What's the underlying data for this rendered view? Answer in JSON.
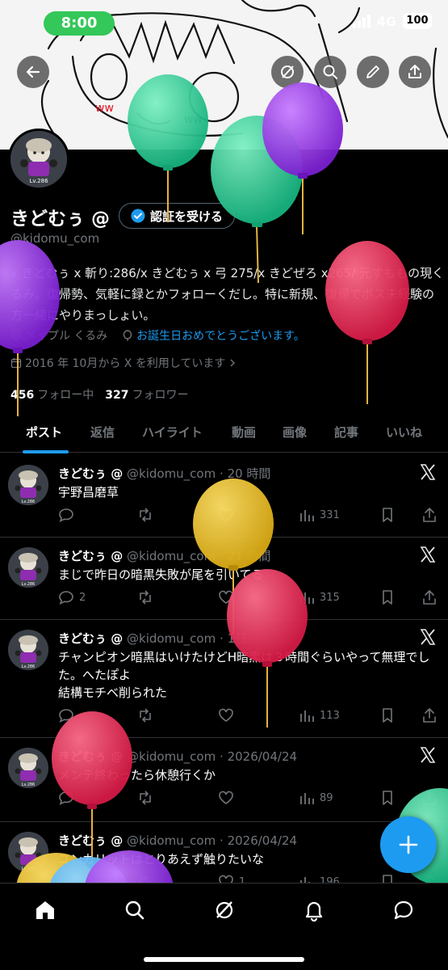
{
  "status_bar": {
    "time": "8:00",
    "network": "4G",
    "battery": "100",
    "accent": "#34c759"
  },
  "top_nav": {
    "icons": [
      "back-arrow-icon",
      "grok-icon",
      "search-icon",
      "pencil-icon",
      "share-icon"
    ]
  },
  "profile": {
    "display_name": "きどむぅ @",
    "verify_label": "認証を受ける",
    "handle": "@kidomu_com",
    "bio_prefix": "x",
    "bio_text": "きどむぅ x 斬り:286/x きどむぅ x 弓 275/x きどぜろ x265/ 元すももの現くるみ。復帰勢、気軽に録とかフォローくだし。特に新規、復帰でボス未経験の方一緒にやりまっしょい。",
    "location": "メイプル くるみ",
    "birthday_link": "お誕生日おめでとうございます。",
    "joined": "2016 年 10月から X を利用しています",
    "following_count": "456",
    "following_label": "フォロー中",
    "followers_count": "327",
    "followers_label": "フォロワー",
    "avatar_level": "Lv.286"
  },
  "tabs": [
    "ポスト",
    "返信",
    "ハイライト",
    "動画",
    "画像",
    "記事",
    "いいね"
  ],
  "posts": [
    {
      "name": "きどむぅ @",
      "handle": "@kidomu_com",
      "time": "20 時間",
      "text": "宇野昌磨草",
      "replies": "",
      "reposts": "",
      "likes": "",
      "views": "331"
    },
    {
      "name": "きどむぅ @",
      "handle": "@kidomu_com",
      "time": "21 時間",
      "text": "まじで昨日の暗黒失敗が尾を引いてる",
      "replies": "2",
      "reposts": "",
      "likes": "",
      "views": "315"
    },
    {
      "name": "きどむぅ @",
      "handle": "@kidomu_com",
      "time": "1日",
      "text": "チャンピオン暗黒はいけたけどH暗黒は３時間ぐらいやって無理でした。へたぽよ\n結構モチベ削られた",
      "replies": "",
      "reposts": "",
      "likes": "",
      "views": "113"
    },
    {
      "name": "きどむぅ @",
      "handle": "@kidomu_com",
      "time": "2026/04/24",
      "text": "メンテ終わったら休憩行くか",
      "replies": "",
      "reposts": "",
      "likes": "",
      "views": "89"
    },
    {
      "name": "きどむぅ @",
      "handle": "@kidomu_com",
      "time": "2026/04/24",
      "text": "ユンカリットはとりあえず触りたいな",
      "replies": "",
      "reposts": "",
      "likes": "1",
      "views": "196"
    }
  ],
  "colors": {
    "accent": "#1d9bf0",
    "muted": "#71767b",
    "divider": "#2f3336"
  },
  "bottom_nav": [
    "home-icon",
    "search-icon",
    "grok-icon",
    "bell-icon",
    "messages-icon"
  ]
}
